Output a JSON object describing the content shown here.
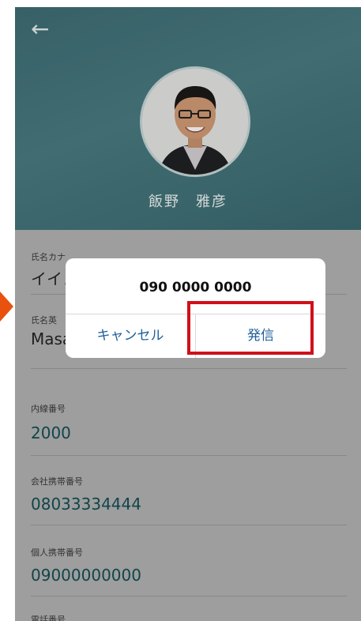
{
  "header": {
    "back_icon": "←",
    "name": "飯野　雅彦"
  },
  "fields": [
    {
      "label": "氏名カナ",
      "value": "イイノ"
    },
    {
      "label": "氏名英",
      "value": "Masa"
    },
    {
      "label": "内線番号",
      "value": "2000"
    },
    {
      "label": "会社携帯番号",
      "value": "08033334444"
    },
    {
      "label": "個人携帯番号",
      "value": "09000000000"
    },
    {
      "label": "電話番号",
      "value": ""
    }
  ],
  "dialog": {
    "number": "090 0000 0000",
    "cancel_label": "キャンセル",
    "call_label": "発信"
  },
  "colors": {
    "header_bg": "#437379",
    "link": "#1e6f78",
    "highlight": "#d0101a",
    "pointer_arrow": "#e8520e"
  }
}
